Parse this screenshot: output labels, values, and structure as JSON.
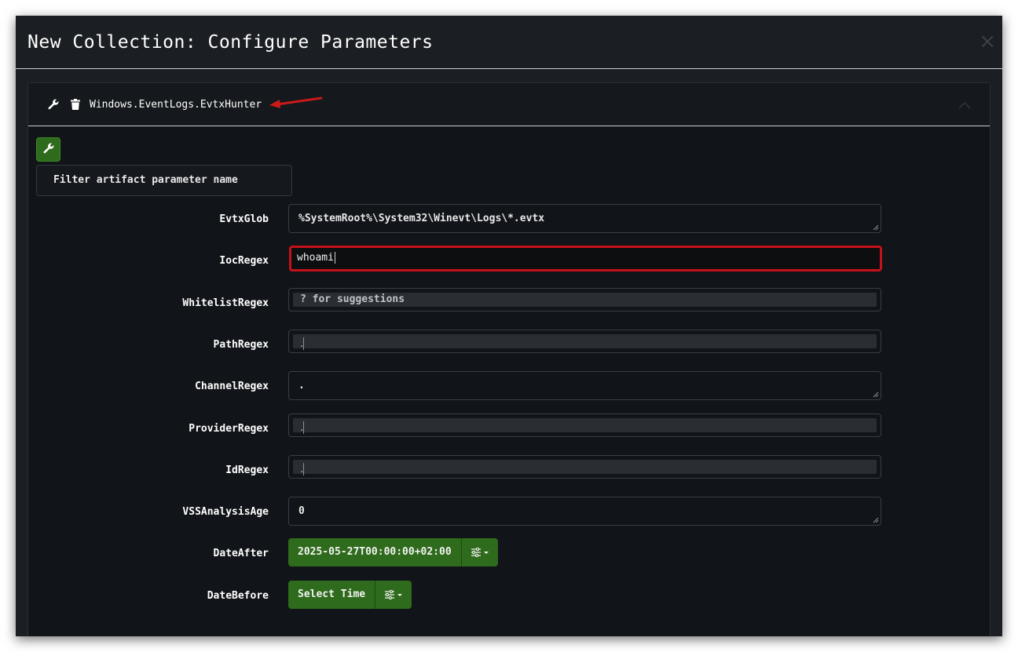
{
  "modal": {
    "title": "New Collection: Configure Parameters",
    "close_label": "×"
  },
  "artifact": {
    "name": "Windows.EventLogs.EvtxHunter"
  },
  "filter": {
    "placeholder": "Filter artifact parameter name"
  },
  "params": {
    "evtxglob": {
      "label": "EvtxGlob",
      "value": "%SystemRoot%\\System32\\Winevt\\Logs\\*.evtx"
    },
    "iocregex": {
      "label": "IocRegex",
      "value": "whoami"
    },
    "whitelistregex": {
      "label": "WhitelistRegex",
      "placeholder": "? for suggestions"
    },
    "pathregex": {
      "label": "PathRegex",
      "value": "."
    },
    "channelregex": {
      "label": "ChannelRegex",
      "value": "."
    },
    "providerregex": {
      "label": "ProviderRegex",
      "value": "."
    },
    "idregex": {
      "label": "IdRegex",
      "value": "."
    },
    "vssanalysisage": {
      "label": "VSSAnalysisAge",
      "value": "0"
    },
    "dateafter": {
      "label": "DateAfter",
      "value": "2025-05-27T00:00:00+02:00"
    },
    "datebefore": {
      "label": "DateBefore",
      "value": "Select Time"
    }
  },
  "icons": {
    "wrench": "wrench-icon",
    "trash": "trash-icon",
    "chevron": "chevron-up-icon",
    "annotation_arrow": "red-arrow",
    "sliders": "sliders-icon",
    "caret": "caret-down-icon"
  },
  "colors": {
    "accent_green": "#2f6b1c",
    "highlight_red": "#c8101a",
    "modal_bg": "#1b1e22"
  }
}
